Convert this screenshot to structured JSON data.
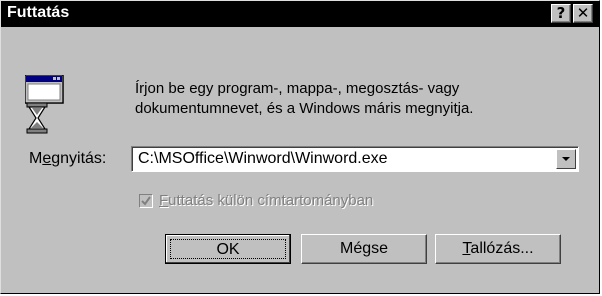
{
  "window": {
    "title": "Futtatás",
    "help_button": "?",
    "close_button": "✕"
  },
  "icon": "run-dialog-hourglass-icon",
  "description": {
    "line1": "Írjon be egy program-, mappa-, megosztás-  vagy",
    "line2": "dokumentumnevet, és a Windows máris megnyitja."
  },
  "open_field": {
    "label_prefix": "M",
    "label_mnemonic": "e",
    "label_suffix": "gnyitás:",
    "value": "C:\\MSOffice\\Winword\\Winword.exe"
  },
  "separate_space_checkbox": {
    "label_mnemonic": "F",
    "label_rest": "uttatás külön címtartományban",
    "checked": true,
    "enabled": false
  },
  "buttons": {
    "ok": "OK",
    "cancel": "Mégse",
    "browse_mnemonic": "T",
    "browse_rest": "allózás..."
  },
  "colors": {
    "titlebar": "#000000",
    "dialog_bg": "#c0c0c0",
    "disabled_text": "#808080"
  }
}
